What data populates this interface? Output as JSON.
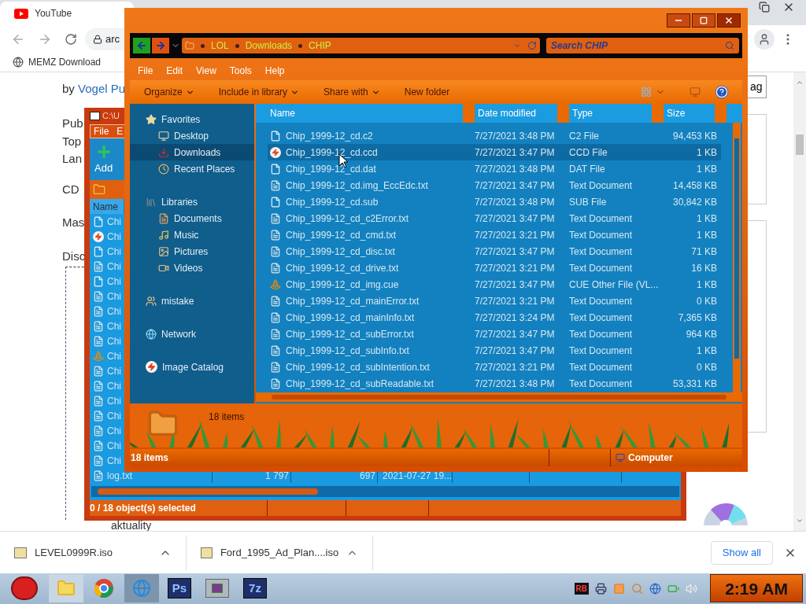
{
  "browser": {
    "tab_title": "YouTube",
    "address": "arc",
    "bookmarks": [
      "MEMZ Download"
    ]
  },
  "page": {
    "byline_prefix": "by",
    "byline_link": "Vogel Pu",
    "fragments": [
      "Pub",
      "Top",
      "Lan",
      "CD",
      "Mas",
      "Disc"
    ],
    "tree_item": "aktuality",
    "side_button": "ag"
  },
  "archiver": {
    "title": "C:\\U",
    "menu": [
      "File",
      "E"
    ],
    "add_label": "Add",
    "column": "Name",
    "rows": [
      {
        "name": "Chi",
        "kind": "blank"
      },
      {
        "name": "Chi",
        "kind": "flash"
      },
      {
        "name": "Chi",
        "kind": "blank"
      },
      {
        "name": "Chi",
        "kind": "text"
      },
      {
        "name": "Chi",
        "kind": "blank"
      },
      {
        "name": "Chi",
        "kind": "text"
      },
      {
        "name": "Chi",
        "kind": "text"
      },
      {
        "name": "Chi",
        "kind": "text"
      },
      {
        "name": "Chi",
        "kind": "text"
      },
      {
        "name": "Chi",
        "kind": "cone"
      },
      {
        "name": "Chi",
        "kind": "text"
      },
      {
        "name": "Chi",
        "kind": "text"
      },
      {
        "name": "Chi",
        "kind": "text"
      },
      {
        "name": "Chi",
        "kind": "text"
      },
      {
        "name": "Chi",
        "kind": "text"
      },
      {
        "name": "Chi",
        "kind": "text"
      },
      {
        "name": "Chi",
        "kind": "text"
      }
    ],
    "last_row": {
      "name": "log.txt",
      "size": "1 797",
      "packed": "697",
      "modified": "2021-07-27 19..."
    },
    "status": "0 / 18 object(s) selected"
  },
  "explorer": {
    "breadcrumb": [
      "LOL",
      "Downloads",
      "CHIP"
    ],
    "search_placeholder": "Search CHIP",
    "menu": [
      "File",
      "Edit",
      "View",
      "Tools",
      "Help"
    ],
    "commands": [
      {
        "label": "Organize",
        "dropdown": true
      },
      {
        "label": "Include in library",
        "dropdown": true
      },
      {
        "label": "Share with",
        "dropdown": true
      },
      {
        "label": "New folder",
        "dropdown": false
      }
    ],
    "nav": [
      {
        "label": "Favorites",
        "kind": "star",
        "selected": false,
        "children": [
          {
            "label": "Desktop",
            "kind": "desktop",
            "selected": false
          },
          {
            "label": "Downloads",
            "kind": "downloads",
            "selected": true
          },
          {
            "label": "Recent Places",
            "kind": "recent",
            "selected": false
          }
        ]
      },
      {
        "label": "Libraries",
        "kind": "library",
        "selected": false,
        "children": [
          {
            "label": "Documents",
            "kind": "documents",
            "selected": false
          },
          {
            "label": "Music",
            "kind": "music",
            "selected": false
          },
          {
            "label": "Pictures",
            "kind": "pictures",
            "selected": false
          },
          {
            "label": "Videos",
            "kind": "videos",
            "selected": false
          }
        ]
      },
      {
        "label": "mistake",
        "kind": "user",
        "selected": false
      },
      {
        "label": "Network",
        "kind": "network",
        "selected": false
      },
      {
        "label": "Image Catalog",
        "kind": "flash",
        "selected": false
      }
    ],
    "columns": [
      "Name",
      "Date modified",
      "Type",
      "Size"
    ],
    "files": [
      {
        "name": "Chip_1999-12_cd.c2",
        "date": "7/27/2021 3:48 PM",
        "type": "C2 File",
        "size": "94,453 KB",
        "kind": "blank",
        "hovered": false
      },
      {
        "name": "Chip_1999-12_cd.ccd",
        "date": "7/27/2021 3:47 PM",
        "type": "CCD File",
        "size": "1 KB",
        "kind": "flash",
        "hovered": true
      },
      {
        "name": "Chip_1999-12_cd.dat",
        "date": "7/27/2021 3:48 PM",
        "type": "DAT File",
        "size": "1 KB",
        "kind": "blank",
        "hovered": false
      },
      {
        "name": "Chip_1999-12_cd.img_EccEdc.txt",
        "date": "7/27/2021 3:47 PM",
        "type": "Text Document",
        "size": "14,458 KB",
        "kind": "text",
        "hovered": false
      },
      {
        "name": "Chip_1999-12_cd.sub",
        "date": "7/27/2021 3:48 PM",
        "type": "SUB File",
        "size": "30,842 KB",
        "kind": "blank",
        "hovered": false
      },
      {
        "name": "Chip_1999-12_cd_c2Error.txt",
        "date": "7/27/2021 3:47 PM",
        "type": "Text Document",
        "size": "1 KB",
        "kind": "text",
        "hovered": false
      },
      {
        "name": "Chip_1999-12_cd_cmd.txt",
        "date": "7/27/2021 3:21 PM",
        "type": "Text Document",
        "size": "1 KB",
        "kind": "text",
        "hovered": false
      },
      {
        "name": "Chip_1999-12_cd_disc.txt",
        "date": "7/27/2021 3:47 PM",
        "type": "Text Document",
        "size": "71 KB",
        "kind": "text",
        "hovered": false
      },
      {
        "name": "Chip_1999-12_cd_drive.txt",
        "date": "7/27/2021 3:21 PM",
        "type": "Text Document",
        "size": "16 KB",
        "kind": "text",
        "hovered": false
      },
      {
        "name": "Chip_1999-12_cd_img.cue",
        "date": "7/27/2021 3:47 PM",
        "type": "CUE Other File (VL...",
        "size": "1 KB",
        "kind": "cone",
        "hovered": false
      },
      {
        "name": "Chip_1999-12_cd_mainError.txt",
        "date": "7/27/2021 3:21 PM",
        "type": "Text Document",
        "size": "0 KB",
        "kind": "text",
        "hovered": false
      },
      {
        "name": "Chip_1999-12_cd_mainInfo.txt",
        "date": "7/27/2021 3:24 PM",
        "type": "Text Document",
        "size": "7,365 KB",
        "kind": "text",
        "hovered": false
      },
      {
        "name": "Chip_1999-12_cd_subError.txt",
        "date": "7/27/2021 3:47 PM",
        "type": "Text Document",
        "size": "964 KB",
        "kind": "text",
        "hovered": false
      },
      {
        "name": "Chip_1999-12_cd_subInfo.txt",
        "date": "7/27/2021 3:47 PM",
        "type": "Text Document",
        "size": "1 KB",
        "kind": "text",
        "hovered": false
      },
      {
        "name": "Chip_1999-12_cd_subIntention.txt",
        "date": "7/27/2021 3:21 PM",
        "type": "Text Document",
        "size": "0 KB",
        "kind": "text",
        "hovered": false
      },
      {
        "name": "Chip_1999-12_cd_subReadable.txt",
        "date": "7/27/2021 3:48 PM",
        "type": "Text Document",
        "size": "53,331 KB",
        "kind": "text",
        "hovered": false
      }
    ],
    "details": "18 items",
    "status": "18 items",
    "zone": "Computer"
  },
  "downloads": {
    "items": [
      "LEVEL0999R.iso",
      "Ford_1995_Ad_Plan....iso"
    ],
    "show_all": "Show all"
  },
  "taskbar": {
    "apps": [
      {
        "kind": "folder"
      },
      {
        "kind": "chrome"
      },
      {
        "kind": "ie"
      },
      {
        "kind": "label",
        "label": "Ps"
      },
      {
        "kind": "window"
      },
      {
        "kind": "label",
        "label": "7z"
      }
    ],
    "tray": [
      {
        "kind": "label",
        "label": "RB"
      },
      {
        "kind": "printer"
      },
      {
        "kind": "app"
      },
      {
        "kind": "search"
      },
      {
        "kind": "globe"
      },
      {
        "kind": "battery"
      },
      {
        "kind": "volume"
      }
    ],
    "clock": "2:19 AM"
  }
}
